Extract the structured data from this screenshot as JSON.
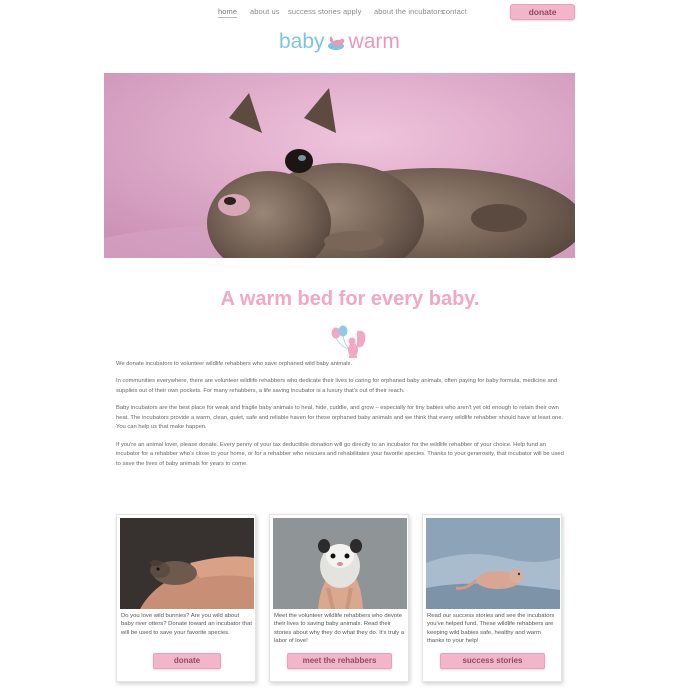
{
  "nav": {
    "items": [
      {
        "label": "home",
        "active": true
      },
      {
        "label": "about us"
      },
      {
        "label": "success stories"
      },
      {
        "label": "apply"
      },
      {
        "label": "about the incubators"
      },
      {
        "label": "contact"
      }
    ],
    "donate_label": "donate"
  },
  "logo": {
    "part1": "baby",
    "part2": "warm",
    "icon": "baby-squirrel-logo"
  },
  "hero": {
    "image": "baby-squirrel-on-pink-blanket"
  },
  "headline": "A warm bed for every baby.",
  "mascot": {
    "icon": "squirrel-with-balloons-icon"
  },
  "body": {
    "paragraphs": [
      "We donate incubators to volunteer wildlife rehabbers who save orphaned wild baby animals.",
      "In communities everywhere, there are volunteer wildlife rehabbers who dedicate their lives to caring for orphaned baby animals, often paying for baby formula, medicine and supplies out of their own pockets. For many rehabbers, a life saving incubator is a luxury that's out of their reach.",
      "Baby incubators are the best place for weak and fragile baby animals to heal, hide, cuddle, and grow – especially for tiny babies who aren't yet old enough to retain their own heat. The incubators provide a warm, clean, quiet, safe and reliable haven for these orphaned baby animals and we think that every wildlife rehabber should have at least one. You can help us that make happen.",
      "If you're an animal lover, please donate. Every penny of your tax deductible donation will go directly to an incubator for the wildlife rehabber of your choice. Help fund an incubator for a rehabber who's close to your home, or for a rehabber who rescues and rehabilitates your favorite species. Thanks to your generosity, that incubator will be used to save the lives of baby animals for years to come."
    ]
  },
  "cards": [
    {
      "image": "baby-bunny-in-hand",
      "text": "Do you love wild bunnies? Are you wild about baby river otters? Donate toward an incubator that will be used to save your favorite species.",
      "button": "donate"
    },
    {
      "image": "baby-opossum-in-hand",
      "text": "Meet the volunteer wildlife rehabbers who devote their lives to saving baby animals. Read their stories about why they do what they do. It's truly a labor of love!",
      "button": "meet the rehabbers"
    },
    {
      "image": "baby-squirrel-on-blanket",
      "text": "Read our success stories and see the incubators you've helped fund. These wildlife rehabbers are keeping wild babies safe, healthy and warm thanks to your help!",
      "button": "success stories"
    }
  ]
}
